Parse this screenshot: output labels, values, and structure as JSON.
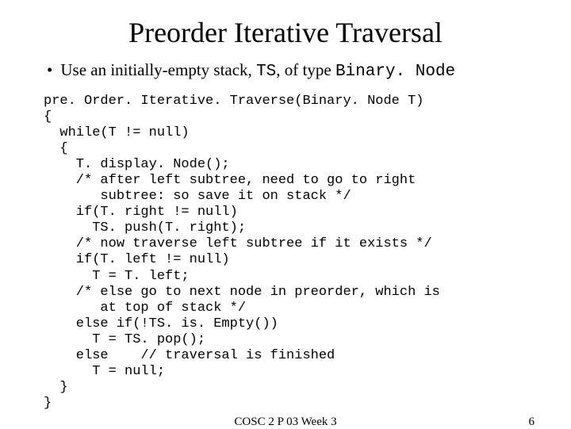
{
  "title": "Preorder Iterative Traversal",
  "bullet": {
    "prefix": "Use an initially-empty stack, ",
    "code1": "TS",
    "middle": ", of type ",
    "code2": "Binary. Node"
  },
  "code": "pre. Order. Iterative. Traverse(Binary. Node T)\n{\n  while(T != null)\n  {\n    T. display. Node();\n    /* after left subtree, need to go to right\n       subtree: so save it on stack */\n    if(T. right != null)\n      TS. push(T. right);\n    /* now traverse left subtree if it exists */\n    if(T. left != null)\n      T = T. left;\n    /* else go to next node in preorder, which is\n       at top of stack */\n    else if(!TS. is. Empty())\n      T = TS. pop();\n    else    // traversal is finished\n      T = null;\n  }\n}",
  "footer": {
    "center": "COSC 2 P 03 Week 3",
    "page": "6"
  }
}
